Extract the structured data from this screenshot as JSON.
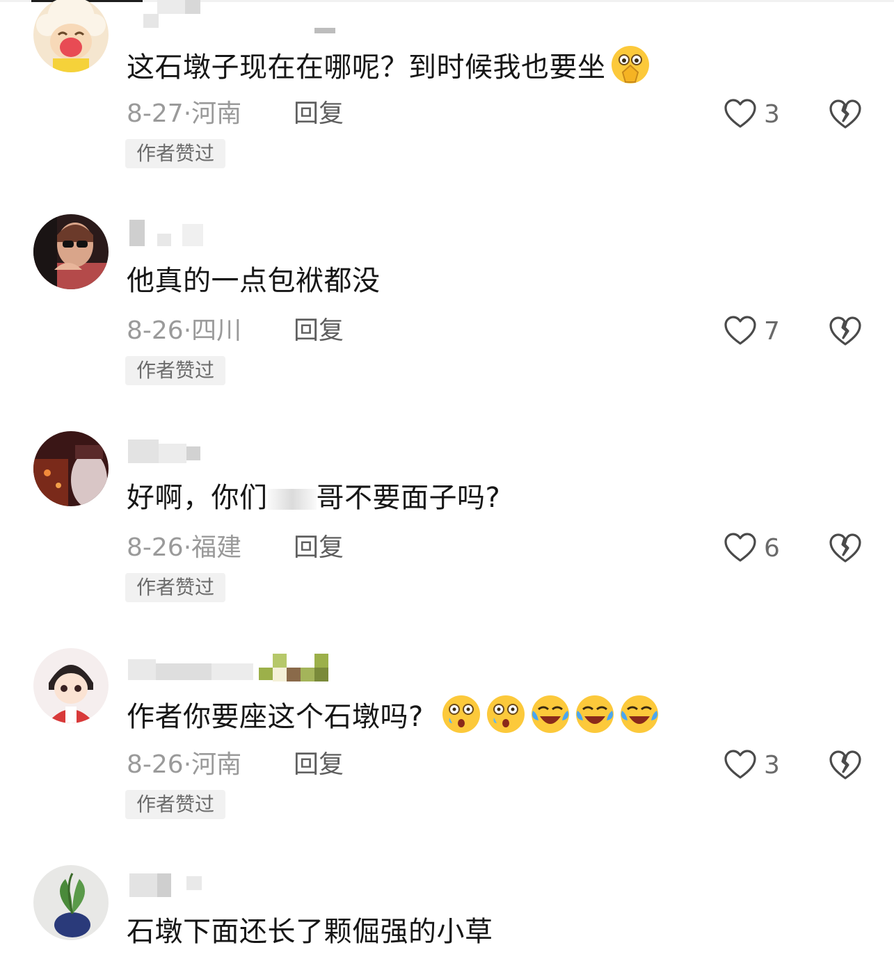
{
  "comments": [
    {
      "text": "这石墩子现在在哪呢？到时候我也要坐",
      "emoji": "pray-eyes-emoji",
      "date": "8-27·",
      "location": "河南",
      "reply": "回复",
      "likes": "3",
      "badge": "作者赞过"
    },
    {
      "text": "他真的一点包袱都没",
      "date": "8-26·",
      "location": "四川",
      "reply": "回复",
      "likes": "7",
      "badge": "作者赞过"
    },
    {
      "text_part1": "好啊，你们",
      "text_part2": "哥不要面子吗?",
      "date": "8-26·",
      "location": "福建",
      "reply": "回复",
      "likes": "6",
      "badge": "作者赞过"
    },
    {
      "text": "作者你要座这个石墩吗?",
      "emojis": [
        "shocked-emoji",
        "shocked-emoji",
        "crying-laughing-emoji",
        "crying-laughing-emoji",
        "crying-laughing-emoji"
      ],
      "date": "8-26·",
      "location": "河南",
      "reply": "回复",
      "likes": "3",
      "badge": "作者赞过"
    },
    {
      "text": "石墩下面还长了颗倔强的小草"
    }
  ],
  "colors": {
    "text": "#161616",
    "meta": "#9a9a9a",
    "reply": "#5f5f5f",
    "badge_bg": "#f1f1f1",
    "icon": "#4a4a4a"
  }
}
